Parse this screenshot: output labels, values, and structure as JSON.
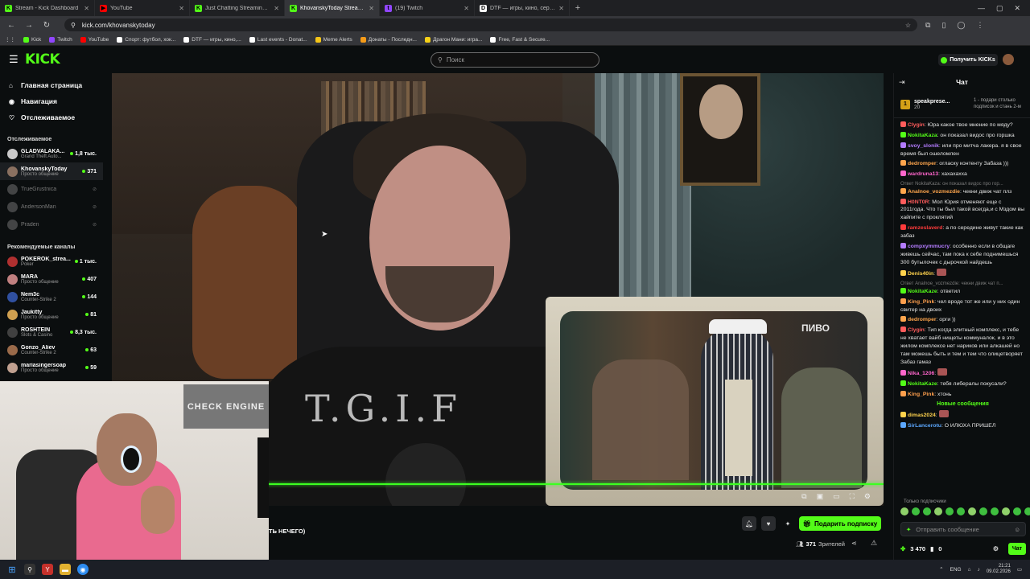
{
  "browser": {
    "tabs": [
      {
        "title": "Stream - Kick Dashboard",
        "fav_color": "#53fc18",
        "fav": "K"
      },
      {
        "title": "YouTube",
        "fav_color": "#ff0000",
        "fav": "▶"
      },
      {
        "title": "Just Chatting Streaming - Live S",
        "fav_color": "#53fc18",
        "fav": "K"
      },
      {
        "title": "KhovanskyToday Stream - Watc",
        "fav_color": "#53fc18",
        "fav": "K",
        "active": true
      },
      {
        "title": "(19) Twitch",
        "fav_color": "#9146ff",
        "fav": "t"
      },
      {
        "title": "DTF — игры, кино, сериалы, р",
        "fav_color": "#ffffff",
        "fav": "D"
      }
    ],
    "url": "kick.com/khovanskytoday",
    "bookmarks": [
      {
        "label": "Kick",
        "color": "#53fc18"
      },
      {
        "label": "Twitch",
        "color": "#9146ff"
      },
      {
        "label": "YouTube",
        "color": "#ff0000"
      },
      {
        "label": "Спорт: футбол, хок...",
        "color": "#ffffff"
      },
      {
        "label": "DTF — игры, кино,...",
        "color": "#ffffff"
      },
      {
        "label": "Last events - Donat...",
        "color": "#ffffff"
      },
      {
        "label": "Meme Alerts",
        "color": "#f5c518"
      },
      {
        "label": "Донаты - Последн...",
        "color": "#f59b18"
      },
      {
        "label": "Драгон Мани: игра...",
        "color": "#f5d018"
      },
      {
        "label": "Free, Fast & Secure...",
        "color": "#ffffff"
      }
    ]
  },
  "kick": {
    "logo": "KICK",
    "search_placeholder": "Поиск",
    "get_kicks": "Получить KICKs"
  },
  "sidebar": {
    "nav": [
      {
        "label": "Главная страница",
        "icon": "home-icon",
        "glyph": "⌂"
      },
      {
        "label": "Навигация",
        "icon": "compass-icon",
        "glyph": "◉"
      },
      {
        "label": "Отслеживаемое",
        "icon": "heart-icon",
        "glyph": "♡"
      }
    ],
    "followed_title": "Отслеживаемое",
    "followed": [
      {
        "name": "GLADVALAKA...",
        "category": "Grand Theft Auto...",
        "viewers": "1,8 тыс.",
        "live": true,
        "color": "#c9c9c9"
      },
      {
        "name": "KhovanskyToday",
        "category": "Просто общение",
        "viewers": "371",
        "live": true,
        "color": "#8a7060",
        "selected": true
      },
      {
        "name": "TrueGrustnica",
        "live": false,
        "color": "#888888"
      },
      {
        "name": "AndersonMan",
        "live": false,
        "color": "#888888"
      },
      {
        "name": "Praden",
        "live": false,
        "color": "#888888"
      }
    ],
    "recommended_title": "Рекомендуемые каналы",
    "recommended": [
      {
        "name": "POKEROK_strea...",
        "category": "Poker",
        "viewers": "1 тыс.",
        "color": "#b03030"
      },
      {
        "name": "MARA",
        "category": "Просто общение",
        "viewers": "407",
        "color": "#c08080"
      },
      {
        "name": "Nem3c",
        "category": "Counter-Strike 2",
        "viewers": "144",
        "color": "#3050a0"
      },
      {
        "name": "Jaukitty",
        "category": "Просто общение",
        "viewers": "81",
        "color": "#d0a050"
      },
      {
        "name": "ROSHTEIN",
        "category": "Slots & Casino",
        "viewers": "8,3 тыс.",
        "color": "#404040"
      },
      {
        "name": "Gonzo_Aliev",
        "category": "Counter-Strike 2",
        "viewers": "63",
        "color": "#9a6a4a"
      },
      {
        "name": "mariasingersoap",
        "category": "Просто общение",
        "viewers": "59",
        "color": "#c0a090"
      }
    ]
  },
  "video": {
    "shirt_text": "T.G.I.F",
    "tv_sign": "ПИВО",
    "cam_sign": "CHECK ENGINE"
  },
  "stream": {
    "title_fragment": "ТЬ НЕЧЕГО)",
    "subscribe_label": "Подарить подписку",
    "viewers_count": "371",
    "viewers_label": "Зрителей"
  },
  "chat": {
    "title": "Чат",
    "gifter_name": "speakprese...",
    "gifter_count": "20",
    "gifter_rank": "1",
    "gifter_promo": "1 - подари столько подписок и стань 2-м",
    "messages": [
      {
        "user": "Clygin",
        "color": "#ff5c5c",
        "text": "Юра какое твое мнение по мяду?"
      },
      {
        "user": "NokitaKaza",
        "color": "#53fc18",
        "text": "он показал видос про горшка"
      },
      {
        "user": "svoy_slonik",
        "color": "#b47cff",
        "text": "или про митча лакера. я в свое время был ошеломлен"
      },
      {
        "user": "dedromper",
        "color": "#ffa64d",
        "text": "огласку контенту Забаза )))"
      },
      {
        "user": "wardruna13",
        "color": "#ff66cc",
        "text": "хахахахха"
      },
      {
        "user": "Analnoe_vozmezdie",
        "color": "#ffa64d",
        "text": "чекни движ чат плз",
        "reply": "Ответ NokitaKaza: он показал видос про гор..."
      },
      {
        "user": "H0NT0R",
        "color": "#ff5c5c",
        "text": "Мол Юрия отменяют еще с 2011года. Что ты был такой всегда,и с Мздом вы хайпите с проклятий"
      },
      {
        "user": "ramzeslaverd",
        "color": "#ff3b3b",
        "text": "а по середине живут такие как забаз"
      },
      {
        "user": "compxymmucry",
        "color": "#b47cff",
        "text": "особенно если в общаге живешь сейчас, там пока к себе поднимешься 300 бутылочек с дырочкой найдешь"
      },
      {
        "user": "Denis40in",
        "color": "#ffd24d",
        "text": ""
      },
      {
        "user": "NokitaKaze",
        "color": "#53fc18",
        "text": "ответил",
        "reply": "Ответ Analnoe_vozmezdie: чекни движ чат п..."
      },
      {
        "user": "King_Pink",
        "color": "#ff9f4d",
        "text": "чел вроде тот же или у них один свитер на двоих"
      },
      {
        "user": "dedromper",
        "color": "#ffa64d",
        "text": "орги ))"
      },
      {
        "user": "Clygin",
        "color": "#ff5c5c",
        "text": "Тип когда элитный комплекс, и тебе не хватает вайб нищеты коммуналок, и в это жилом комплексе нет нариков или алкашей но там можешь быть и тем и тем что олицетворяет Забаз гамаз"
      },
      {
        "user": "Nika_1206",
        "color": "#ff66cc",
        "text": ""
      },
      {
        "user": "NokitaKaze",
        "color": "#53fc18",
        "text": "тебя либералы покусали?"
      },
      {
        "user": "King_Pink",
        "color": "#ff9f4d",
        "text": "хтонь"
      }
    ],
    "new_messages_label": "Новые сообщения",
    "new_messages": [
      {
        "user": "dimas2024",
        "color": "#ffd24d",
        "text": ""
      },
      {
        "user": "SirLancerotu",
        "color": "#5ca8ff",
        "text": "О ИЛЮХА ПРИШЕЛ"
      }
    ],
    "sub_only": "Только подписчики",
    "input_placeholder": "Отправить сообщение",
    "kicks_balance": "3 470",
    "points": "0",
    "chat_button": "Чат"
  },
  "taskbar": {
    "lang": "ENG",
    "time": "21:21",
    "date": "09.02.2026"
  }
}
